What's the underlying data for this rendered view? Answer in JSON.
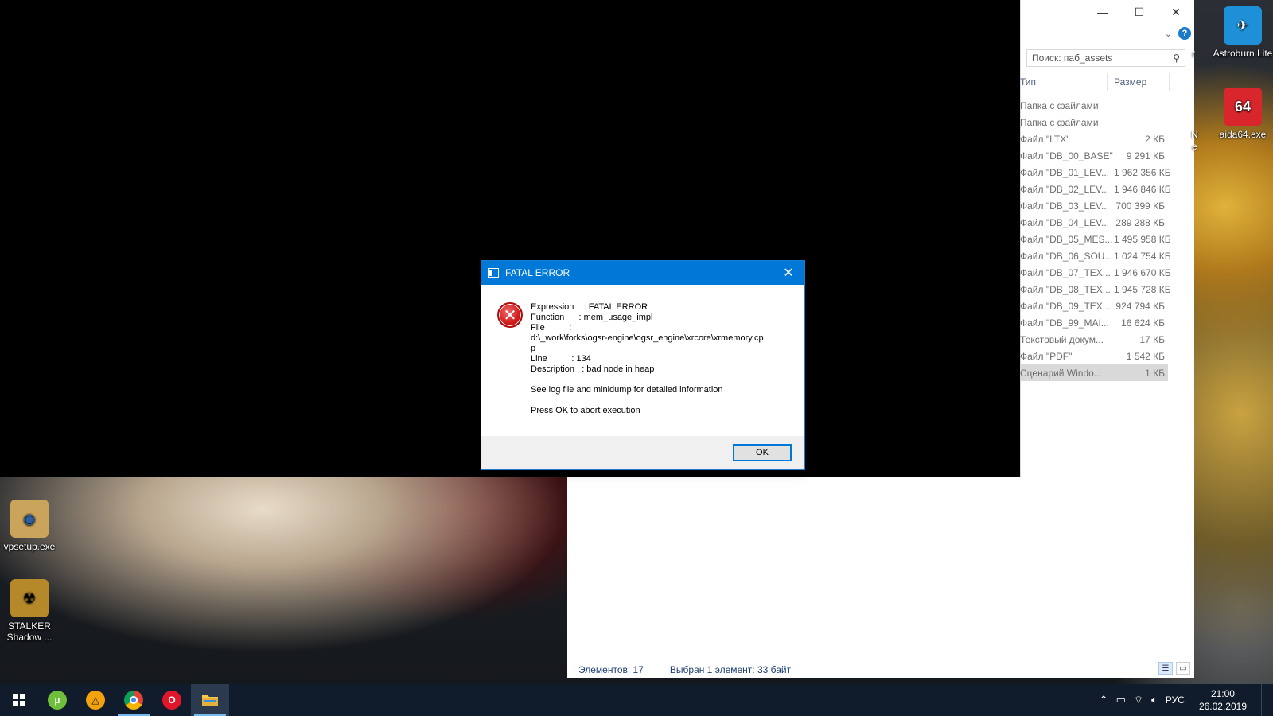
{
  "error_dialog": {
    "title": "FATAL ERROR",
    "lines": [
      "Expression    : FATAL ERROR",
      "Function      : mem_usage_impl",
      "File          :",
      "d:\\_work\\forks\\ogsr-engine\\ogsr_engine\\xrcore\\xrmemory.cp",
      "p",
      "Line          : 134",
      "Description   : bad node in heap"
    ],
    "info_text": "See log file and minidump for detailed information",
    "abort_text": "Press OK to abort execution",
    "ok_label": "OK"
  },
  "explorer": {
    "search_placeholder": "Поиск: паб_assets",
    "columns": {
      "type": "Тип",
      "size": "Размер"
    },
    "rows": [
      {
        "type": "Папка с файлами",
        "size": ""
      },
      {
        "type": "Папка с файлами",
        "size": ""
      },
      {
        "type": "Файл \"LTX\"",
        "size": "2 КБ"
      },
      {
        "type": "Файл \"DB_00_BASE\"",
        "size": "9 291 КБ"
      },
      {
        "type": "Файл \"DB_01_LEV...",
        "size": "1 962 356 КБ"
      },
      {
        "type": "Файл \"DB_02_LEV...",
        "size": "1 946 846 КБ"
      },
      {
        "type": "Файл \"DB_03_LEV...",
        "size": "700 399 КБ"
      },
      {
        "type": "Файл \"DB_04_LEV...",
        "size": "289 288 КБ"
      },
      {
        "type": "Файл \"DB_05_MES...",
        "size": "1 495 958 КБ"
      },
      {
        "type": "Файл \"DB_06_SOU...",
        "size": "1 024 754 КБ"
      },
      {
        "type": "Файл \"DB_07_TEX...",
        "size": "1 946 670 КБ"
      },
      {
        "type": "Файл \"DB_08_TEX...",
        "size": "1 945 728 КБ"
      },
      {
        "type": "Файл \"DB_09_TEX...",
        "size": "924 794 КБ"
      },
      {
        "type": "Файл \"DB_99_MAI...",
        "size": "16 624 КБ"
      },
      {
        "type": "Текстовый докум...",
        "size": "17 КБ"
      },
      {
        "type": "Файл \"PDF\"",
        "size": "1 542 КБ"
      },
      {
        "type": "Сценарий Windo...",
        "size": "1 КБ",
        "selected": true
      }
    ],
    "status_items": "Элементов: 17",
    "status_selected": "Выбран 1 элемент: 33 байт"
  },
  "desktop_icons": [
    {
      "label": "Astroburn Lite",
      "icon": "astroburn-icon",
      "color": "#1e90d8"
    },
    {
      "label": "aida64.exe",
      "icon": "aida64-icon",
      "color": "#d8262c",
      "glyph": "64"
    },
    {
      "label": "vpsetup.exe",
      "icon": "vpsetup-icon",
      "color": "#c9a45a"
    },
    {
      "label": "STALKER Shadow ...",
      "icon": "stalker-icon",
      "color": "#b5892a"
    }
  ],
  "partial_labels": {
    "r": "r",
    "n": "N",
    "e": "e"
  },
  "taskbar": {
    "apps": [
      {
        "name": "start",
        "icon": "windows-icon"
      },
      {
        "name": "utorrent",
        "icon": "utorrent-icon",
        "color": "#6fbf3a",
        "glyph": "µ"
      },
      {
        "name": "aimp",
        "icon": "aimp-icon",
        "color": "#f2a20c",
        "glyph": "△"
      },
      {
        "name": "chrome",
        "icon": "chrome-icon",
        "color": "#db4437"
      },
      {
        "name": "opera",
        "icon": "opera-icon",
        "color": "#e0162b",
        "glyph": "O"
      },
      {
        "name": "explorer",
        "icon": "folder-icon",
        "color": "#f7c948"
      }
    ],
    "language": "РУС",
    "time": "21:00",
    "date": "26.02.2019"
  }
}
